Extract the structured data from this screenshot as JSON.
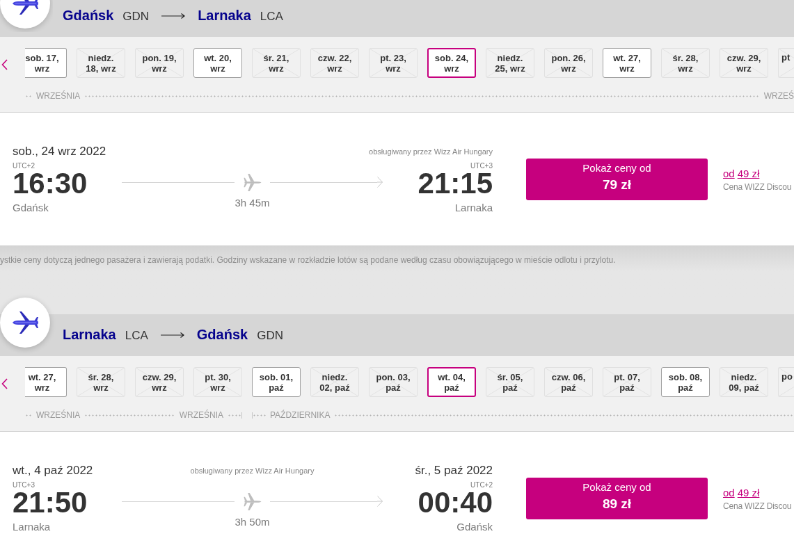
{
  "sections": [
    {
      "header": {
        "origin": {
          "city": "Gdańsk",
          "code": "GDN"
        },
        "destination": {
          "city": "Larnaka",
          "code": "LCA"
        }
      },
      "date_strip": {
        "months": [
          {
            "start_label": "WRZEŚNIA",
            "end_label": "WRZEŚ",
            "dates": [
              {
                "label": "sob. 17, wrz",
                "available": true,
                "selected": false
              },
              {
                "label": "niedz. 18, wrz",
                "available": false,
                "selected": false
              },
              {
                "label": "pon. 19, wrz",
                "available": false,
                "selected": false
              },
              {
                "label": "wt. 20, wrz",
                "available": true,
                "selected": false
              },
              {
                "label": "śr. 21, wrz",
                "available": false,
                "selected": false
              },
              {
                "label": "czw. 22, wrz",
                "available": false,
                "selected": false
              },
              {
                "label": "pt. 23, wrz",
                "available": false,
                "selected": false
              },
              {
                "label": "sob. 24, wrz",
                "available": true,
                "selected": true
              },
              {
                "label": "niedz. 25, wrz",
                "available": false,
                "selected": false
              },
              {
                "label": "pon. 26, wrz",
                "available": false,
                "selected": false
              },
              {
                "label": "wt. 27, wrz",
                "available": true,
                "selected": false
              },
              {
                "label": "śr. 28, wrz",
                "available": false,
                "selected": false
              },
              {
                "label": "czw. 29, wrz",
                "available": false,
                "selected": false
              },
              {
                "label": "pt",
                "available": false,
                "selected": false
              }
            ]
          }
        ]
      },
      "flight": {
        "departure_date": "sob., 24 wrz 2022",
        "departure_timezone": "UTC+2",
        "departure_time": "16:30",
        "departure_city": "Gdańsk",
        "operator": "obsługiwany przez Wizz Air Hungary",
        "duration": "3h 45m",
        "arrival_timezone": "UTC+3",
        "arrival_time": "21:15",
        "arrival_city": "Larnaka",
        "price_button": {
          "label": "Pokaż ceny od",
          "price": "79 zł"
        },
        "discount": {
          "prefix": "od",
          "price": "49 zł",
          "note": "Cena WIZZ Discou"
        }
      },
      "footnote": "ystkie ceny dotyczą jednego pasażera i zawierają podatki. Godziny wskazane w rozkładzie lotów są podane według czasu obowiązującego w mieście odlotu i przylotu."
    },
    {
      "header": {
        "origin": {
          "city": "Larnaka",
          "code": "LCA"
        },
        "destination": {
          "city": "Gdańsk",
          "code": "GDN"
        }
      },
      "date_strip": {
        "months": [
          {
            "start_label": "WRZEŚNIA",
            "end_label": "WRZEŚNIA",
            "dates": [
              {
                "label": "wt. 27, wrz",
                "available": true,
                "selected": false
              },
              {
                "label": "śr. 28, wrz",
                "available": false,
                "selected": false
              },
              {
                "label": "czw. 29, wrz",
                "available": false,
                "selected": false
              },
              {
                "label": "pt. 30, wrz",
                "available": false,
                "selected": false
              }
            ]
          },
          {
            "start_label": "PAŹDZIERNIKA",
            "dates": [
              {
                "label": "sob. 01, paź",
                "available": true,
                "selected": false
              },
              {
                "label": "niedz. 02, paź",
                "available": false,
                "selected": false
              },
              {
                "label": "pon. 03, paź",
                "available": false,
                "selected": false
              },
              {
                "label": "wt. 04, paź",
                "available": true,
                "selected": true
              },
              {
                "label": "śr. 05, paź",
                "available": false,
                "selected": false
              },
              {
                "label": "czw. 06, paź",
                "available": false,
                "selected": false
              },
              {
                "label": "pt. 07, paź",
                "available": false,
                "selected": false
              },
              {
                "label": "sob. 08, paź",
                "available": true,
                "selected": false
              },
              {
                "label": "niedz. 09, paź",
                "available": false,
                "selected": false
              },
              {
                "label": "po",
                "available": false,
                "selected": false
              }
            ]
          }
        ]
      },
      "flight": {
        "departure_date": "wt., 4 paź 2022",
        "departure_timezone": "UTC+3",
        "departure_time": "21:50",
        "departure_city": "Larnaka",
        "operator": "obsługiwany przez Wizz Air Hungary",
        "duration": "3h 50m",
        "arrival_date": "śr., 5 paź 2022",
        "arrival_timezone": "UTC+2",
        "arrival_time": "00:40",
        "arrival_city": "Gdańsk",
        "price_button": {
          "label": "Pokaż ceny od",
          "price": "89 zł"
        },
        "discount": {
          "prefix": "od",
          "price": "49 zł",
          "note": "Cena WIZZ Discou"
        }
      }
    }
  ]
}
